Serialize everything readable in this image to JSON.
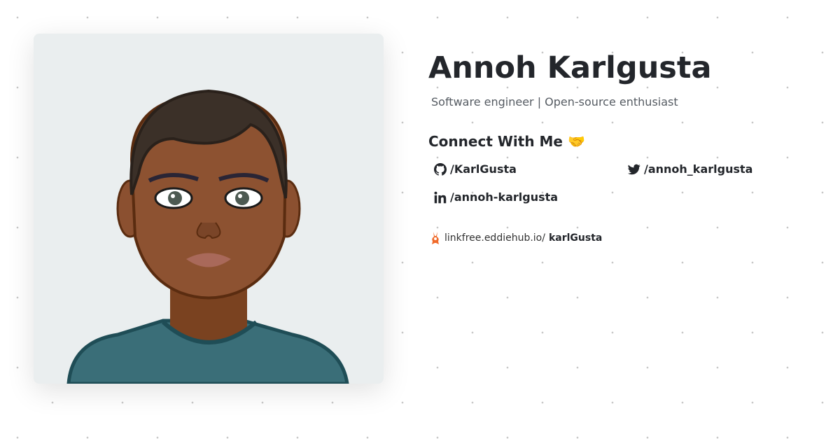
{
  "profile": {
    "name": "Annoh Karlgusta",
    "subtitle": "Software engineer | Open-source enthusiast"
  },
  "connect": {
    "heading": "Connect With Me",
    "heading_emoji": "🤝",
    "links": [
      {
        "icon": "github-icon",
        "label": "/KarlGusta"
      },
      {
        "icon": "twitter-icon",
        "label": "/annoh_karlgusta"
      },
      {
        "icon": "linkedin-icon",
        "label": "/annoh-karlgusta"
      }
    ]
  },
  "linkfree": {
    "prefix": "linkfree.eddiehub.io/",
    "username": "karlGusta"
  }
}
